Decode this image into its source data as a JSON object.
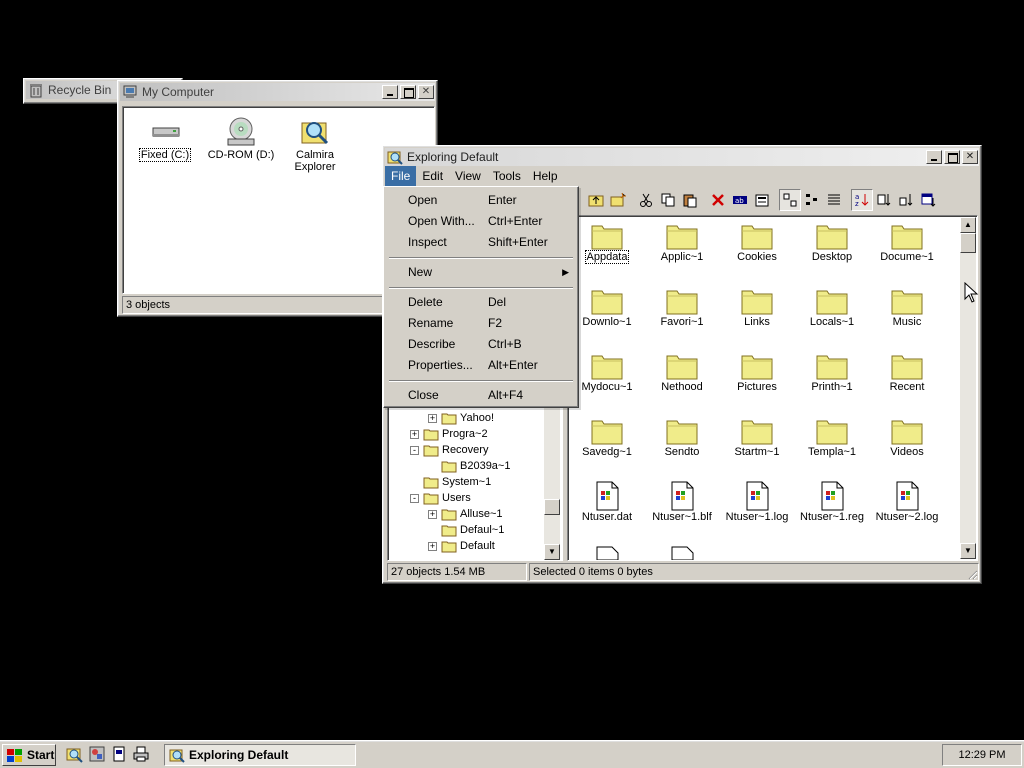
{
  "windows": {
    "recycle_bin": {
      "title": "Recycle Bin"
    },
    "my_computer": {
      "title": "My Computer",
      "items": [
        {
          "label": "Fixed (C:)",
          "icon": "hard-drive-icon"
        },
        {
          "label": "CD-ROM (D:)",
          "icon": "cd-rom-icon"
        },
        {
          "label": "Calmira Explorer",
          "icon": "explorer-icon"
        }
      ],
      "status": "3 objects"
    },
    "explorer": {
      "title": "Exploring Default",
      "menus": [
        "File",
        "Edit",
        "View",
        "Tools",
        "Help"
      ],
      "tree": [
        {
          "label": "Yahoo!",
          "depth": 2,
          "expander": "+"
        },
        {
          "label": "Progra~2",
          "depth": 1,
          "expander": "+"
        },
        {
          "label": "Recovery",
          "depth": 1,
          "expander": "-"
        },
        {
          "label": "B2039a~1",
          "depth": 2,
          "expander": ""
        },
        {
          "label": "System~1",
          "depth": 1,
          "expander": ""
        },
        {
          "label": "Users",
          "depth": 1,
          "expander": "-"
        },
        {
          "label": "Alluse~1",
          "depth": 2,
          "expander": "+"
        },
        {
          "label": "Defaul~1",
          "depth": 2,
          "expander": ""
        },
        {
          "label": "Default",
          "depth": 2,
          "expander": "+"
        }
      ],
      "files": [
        {
          "name": "Appdata",
          "type": "folder"
        },
        {
          "name": "Applic~1",
          "type": "folder"
        },
        {
          "name": "Cookies",
          "type": "folder"
        },
        {
          "name": "Desktop",
          "type": "folder"
        },
        {
          "name": "Docume~1",
          "type": "folder"
        },
        {
          "name": "Downlo~1",
          "type": "folder"
        },
        {
          "name": "Favori~1",
          "type": "folder"
        },
        {
          "name": "Links",
          "type": "folder"
        },
        {
          "name": "Locals~1",
          "type": "folder"
        },
        {
          "name": "Music",
          "type": "folder"
        },
        {
          "name": "Mydocu~1",
          "type": "folder"
        },
        {
          "name": "Nethood",
          "type": "folder"
        },
        {
          "name": "Pictures",
          "type": "folder"
        },
        {
          "name": "Printh~1",
          "type": "folder"
        },
        {
          "name": "Recent",
          "type": "folder"
        },
        {
          "name": "Savedg~1",
          "type": "folder"
        },
        {
          "name": "Sendto",
          "type": "folder"
        },
        {
          "name": "Startm~1",
          "type": "folder"
        },
        {
          "name": "Templa~1",
          "type": "folder"
        },
        {
          "name": "Videos",
          "type": "folder"
        },
        {
          "name": "Ntuser.dat",
          "type": "file"
        },
        {
          "name": "Ntuser~1.blf",
          "type": "file"
        },
        {
          "name": "Ntuser~1.log",
          "type": "file"
        },
        {
          "name": "Ntuser~1.reg",
          "type": "file"
        },
        {
          "name": "Ntuser~2.log",
          "type": "file"
        }
      ],
      "status_left": "27 objects  1.54 MB",
      "status_right": "Selected 0 items  0 bytes"
    }
  },
  "file_menu": {
    "groups": [
      [
        {
          "label": "Open",
          "shortcut": "Enter"
        },
        {
          "label": "Open With...",
          "shortcut": "Ctrl+Enter"
        },
        {
          "label": "Inspect",
          "shortcut": "Shift+Enter"
        }
      ],
      [
        {
          "label": "New",
          "shortcut": "",
          "submenu": true
        }
      ],
      [
        {
          "label": "Delete",
          "shortcut": "Del"
        },
        {
          "label": "Rename",
          "shortcut": "F2"
        },
        {
          "label": "Describe",
          "shortcut": "Ctrl+B"
        },
        {
          "label": "Properties...",
          "shortcut": "Alt+Enter"
        }
      ],
      [
        {
          "label": "Close",
          "shortcut": "Alt+F4"
        }
      ]
    ]
  },
  "taskbar": {
    "start_label": "Start",
    "task_label": "Exploring Default",
    "clock": "12:29 PM"
  },
  "colors": {
    "desktop": "#000000",
    "face": "#d4d0c8",
    "menu_highlight": "#3a6ea5",
    "folder": "#f0ec8a"
  }
}
